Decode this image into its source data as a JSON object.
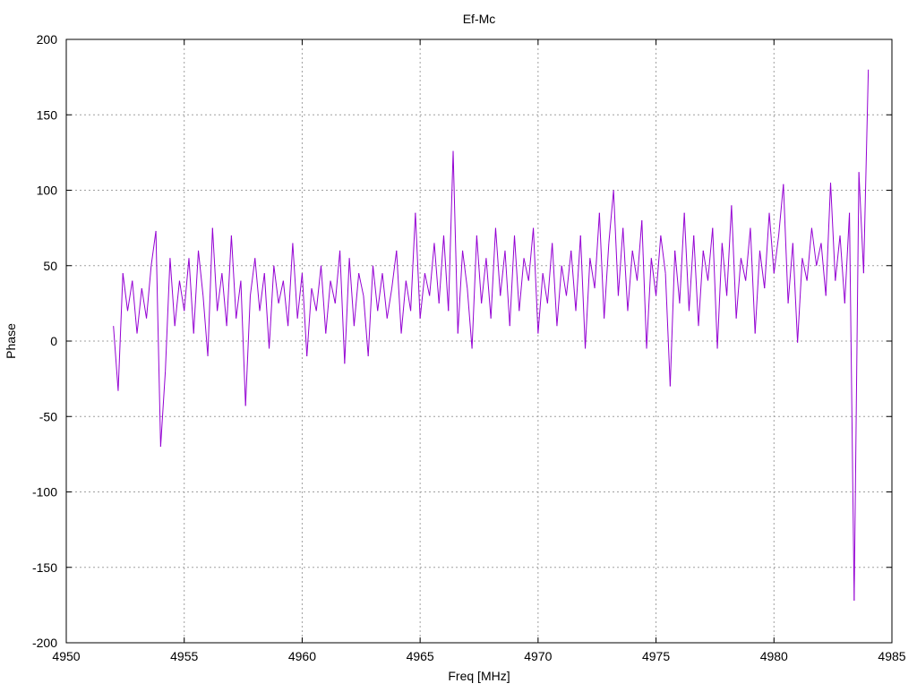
{
  "chart_data": {
    "type": "line",
    "title": "Ef-Mc",
    "xlabel": "Freq [MHz]",
    "ylabel": "Phase",
    "xlim": [
      4950,
      4985
    ],
    "ylim": [
      -200,
      200
    ],
    "xticks": [
      4950,
      4955,
      4960,
      4965,
      4970,
      4975,
      4980,
      4985
    ],
    "yticks": [
      -200,
      -150,
      -100,
      -50,
      0,
      50,
      100,
      150,
      200
    ],
    "grid": true,
    "line_color": "#9400d3",
    "series": [
      {
        "name": "Ef-Mc",
        "x_start": 4952,
        "x_step": 0.2,
        "values": [
          10,
          -33,
          45,
          20,
          40,
          5,
          35,
          15,
          50,
          73,
          -70,
          -20,
          55,
          10,
          40,
          20,
          55,
          5,
          60,
          30,
          -10,
          75,
          20,
          45,
          10,
          70,
          15,
          40,
          -43,
          30,
          55,
          20,
          45,
          -5,
          50,
          25,
          40,
          10,
          65,
          15,
          45,
          -10,
          35,
          20,
          50,
          5,
          40,
          25,
          60,
          -15,
          55,
          10,
          45,
          30,
          -10,
          50,
          20,
          45,
          15,
          35,
          60,
          5,
          40,
          20,
          85,
          15,
          45,
          30,
          65,
          25,
          70,
          20,
          126,
          5,
          60,
          35,
          -5,
          70,
          25,
          55,
          15,
          75,
          30,
          60,
          10,
          70,
          20,
          55,
          40,
          75,
          5,
          45,
          25,
          65,
          10,
          50,
          30,
          60,
          20,
          70,
          -5,
          55,
          35,
          85,
          15,
          65,
          100,
          30,
          75,
          20,
          60,
          40,
          80,
          -5,
          55,
          30,
          70,
          45,
          -30,
          60,
          25,
          85,
          20,
          70,
          10,
          60,
          40,
          75,
          -5,
          65,
          30,
          90,
          15,
          55,
          40,
          75,
          5,
          60,
          35,
          85,
          45,
          70,
          104,
          25,
          65,
          -1,
          55,
          40,
          75,
          50,
          65,
          30,
          105,
          40,
          70,
          25,
          85,
          -172,
          112,
          45,
          180
        ]
      }
    ]
  }
}
